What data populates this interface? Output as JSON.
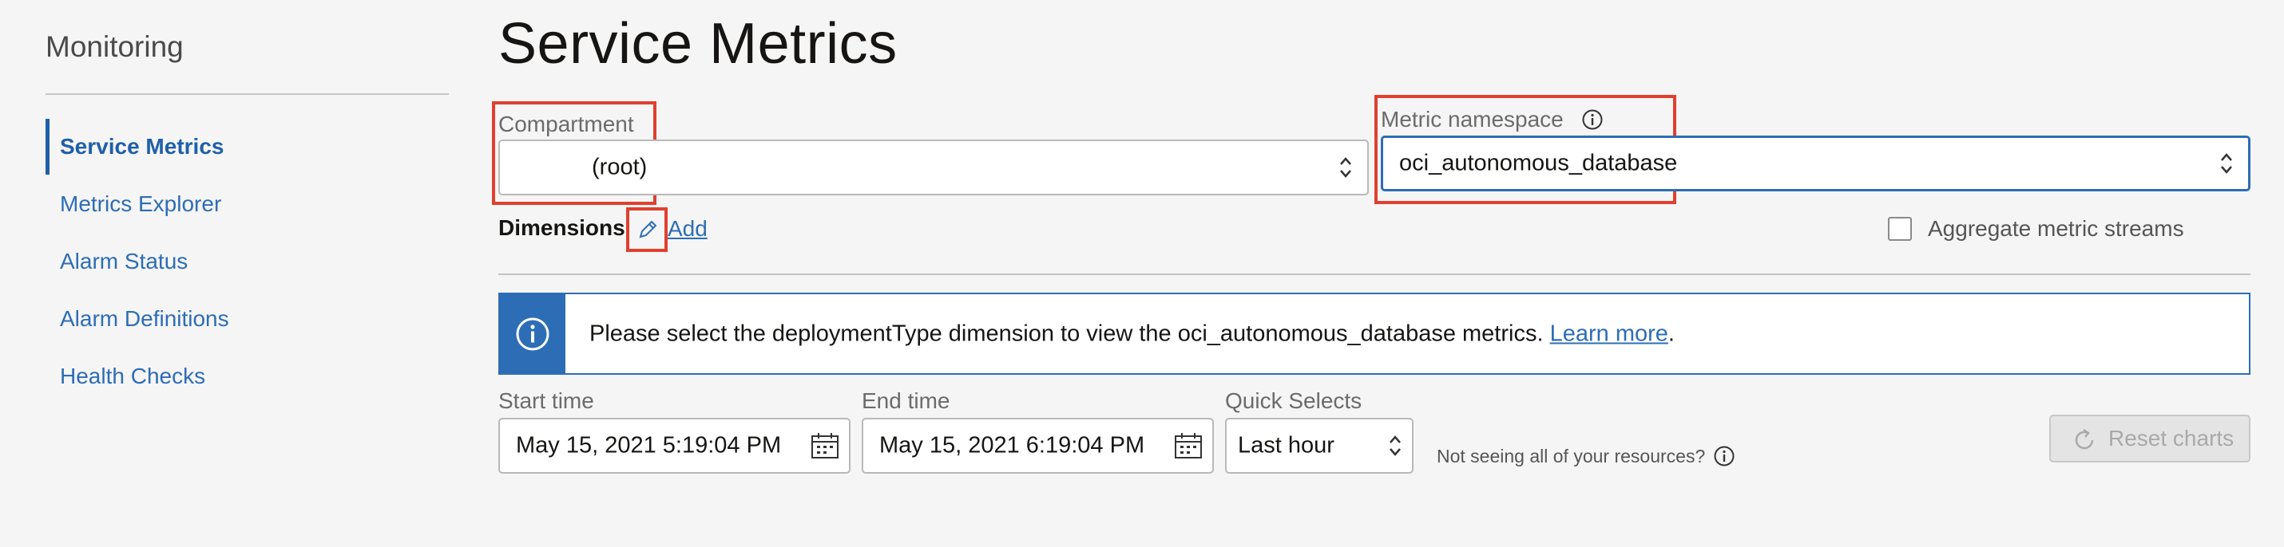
{
  "sidebar": {
    "title": "Monitoring",
    "items": [
      {
        "label": "Service Metrics"
      },
      {
        "label": "Metrics Explorer"
      },
      {
        "label": "Alarm Status"
      },
      {
        "label": "Alarm Definitions"
      },
      {
        "label": "Health Checks"
      }
    ]
  },
  "main": {
    "title": "Service Metrics",
    "compartment": {
      "label": "Compartment",
      "value": "(root)"
    },
    "namespace": {
      "label": "Metric namespace",
      "value": "oci_autonomous_database"
    },
    "dimensions": {
      "label": "Dimensions",
      "add_label": "Add"
    },
    "aggregate": {
      "label": "Aggregate metric streams",
      "checked": false
    },
    "info": {
      "message": "Please select the deploymentType dimension to view the oci_autonomous_database metrics.",
      "link": "Learn more",
      "period": "."
    },
    "start_time": {
      "label": "Start time",
      "value": "May 15, 2021 5:19:04 PM"
    },
    "end_time": {
      "label": "End time",
      "value": "May 15, 2021 6:19:04 PM"
    },
    "quick_selects": {
      "label": "Quick Selects",
      "value": "Last hour"
    },
    "hint": "Not seeing all of your resources?",
    "reset_label": "Reset charts"
  },
  "colors": {
    "accent": "#2d6db5",
    "highlight": "#e0402f",
    "background": "#f5f5f5"
  }
}
